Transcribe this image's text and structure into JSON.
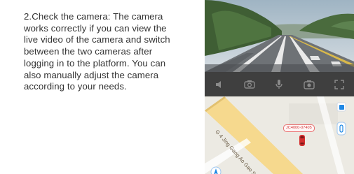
{
  "instructions": {
    "line1": "2.Check the camera: The camera",
    "line2": "works correctly if you can view the",
    "line3": "live video of the camera and switch",
    "line4": "between the two cameras after",
    "line5": "logging in to the platform. You can",
    "line6": "also manually adjust the camera",
    "line7": "according to your needs."
  },
  "video_controls": {
    "icons": [
      "speaker-icon",
      "camera-switch-icon",
      "microphone-icon",
      "snapshot-icon",
      "fullscreen-icon"
    ]
  },
  "map": {
    "road_name": "G 4 Jing Gang Ao Gao Su",
    "vehicle_plate": "JC4000-07405"
  },
  "colors": {
    "controls_bar": "#3f3f3f",
    "accent_blue": "#1e88e5",
    "vehicle_red": "#d32f2f",
    "road_yellow": "#f6d98e"
  }
}
